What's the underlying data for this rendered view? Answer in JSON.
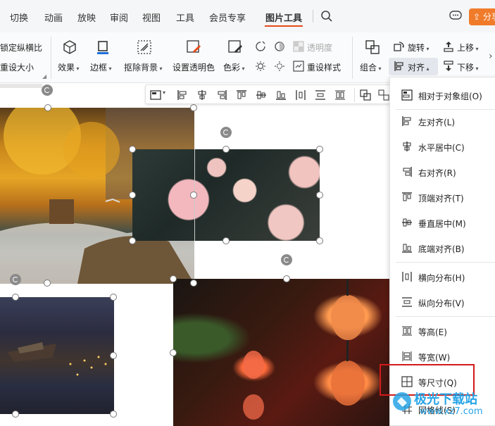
{
  "tabs": [
    {
      "label": "切换"
    },
    {
      "label": "动画"
    },
    {
      "label": "放映"
    },
    {
      "label": "审阅"
    },
    {
      "label": "视图"
    },
    {
      "label": "工具"
    },
    {
      "label": "会员专享"
    },
    {
      "label": "图片工具"
    }
  ],
  "active_tab": "图片工具",
  "share_label": "分享",
  "ribbon": {
    "lock_ratio": "锁定纵横比",
    "reset_size": "重设大小",
    "effects": "效果",
    "border": "边框",
    "remove_bg": "抠除背景",
    "set_transparent": "设置透明色",
    "color": "色彩",
    "transparency": "透明度",
    "reset_style": "重设样式",
    "group": "组合",
    "rotate": "旋转",
    "align": "对齐",
    "move_up": "上移",
    "move_down": "下移"
  },
  "menu": {
    "items": [
      {
        "label": "相对于对象组(O)",
        "icon": "align-relative-icon"
      },
      {
        "label": "左对齐(L)",
        "icon": "align-left-icon"
      },
      {
        "label": "水平居中(C)",
        "icon": "align-center-horizontal-icon"
      },
      {
        "label": "右对齐(R)",
        "icon": "align-right-icon"
      },
      {
        "label": "顶端对齐(T)",
        "icon": "align-top-icon"
      },
      {
        "label": "垂直居中(M)",
        "icon": "align-middle-vertical-icon"
      },
      {
        "label": "底端对齐(B)",
        "icon": "align-bottom-icon"
      },
      {
        "label": "横向分布(H)",
        "icon": "distribute-horizontal-icon"
      },
      {
        "label": "纵向分布(V)",
        "icon": "distribute-vertical-icon"
      },
      {
        "label": "等高(E)",
        "icon": "same-height-icon"
      },
      {
        "label": "等宽(W)",
        "icon": "same-width-icon"
      },
      {
        "label": "等尺寸(Q)",
        "icon": "same-size-icon"
      },
      {
        "label": "网格线(S)",
        "icon": "gridlines-icon"
      }
    ]
  },
  "watermark": {
    "text": "极光下载站",
    "url": "www.xz7.com"
  },
  "colors": {
    "accent": "#e64a19",
    "share_button": "#f07b2a",
    "highlight": "#d21a1a",
    "watermark": "#27a4e6"
  }
}
